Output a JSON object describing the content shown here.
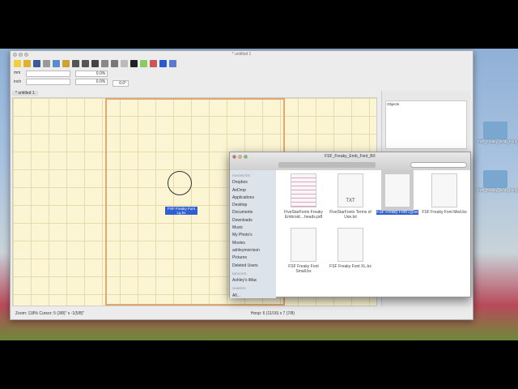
{
  "app": {
    "title": "* untitled 1",
    "tab": "* untitled 1",
    "fields": [
      {
        "unit": "mm",
        "value": "0.0%"
      },
      {
        "unit": "inch",
        "value": "0.0%"
      }
    ],
    "angle": "0.0°",
    "panel_header": "Objects",
    "status_left": "Zoom: 118% Cursor: 5 (3/8)\" x -1(5/8)\"",
    "status_right": "Hoop: 6 (11/16) x 7 (7/8)",
    "canvas_object_label": "FSF Freaky Font Lg.bx"
  },
  "finder": {
    "title": "FSF_Freaky_Emb_Font_BX",
    "search_placeholder": "",
    "sidebar": [
      {
        "section": "FAVORITES"
      },
      {
        "label": "Dropbox"
      },
      {
        "label": "AirDrop"
      },
      {
        "label": "Applications"
      },
      {
        "label": "Desktop"
      },
      {
        "label": "Documents"
      },
      {
        "label": "Downloads"
      },
      {
        "label": "Music"
      },
      {
        "label": "My Photo's"
      },
      {
        "label": "Movies"
      },
      {
        "label": "ashleymorrison"
      },
      {
        "label": "Pictures"
      },
      {
        "label": "Deleted Users"
      },
      {
        "section": "DEVICES"
      },
      {
        "label": "Ashley's iMac"
      },
      {
        "section": "SHARED"
      },
      {
        "label": "All..."
      }
    ],
    "files": [
      {
        "name": "FiveStarFonts Freaky Embroid....heads.pdf",
        "kind": "pdf"
      },
      {
        "name": "FiveStarFonts Terms of Use.txt",
        "kind": "TXT"
      },
      {
        "name": "FSF Freaky Font Lg.bx",
        "kind": "doc",
        "selected": true
      },
      {
        "name": "FSF Freaky Font Med.bx",
        "kind": "doc"
      },
      {
        "name": "FSF Freaky Font Small.bx",
        "kind": "doc"
      },
      {
        "name": "FSF Freaky Font XL.bx",
        "kind": "doc"
      }
    ]
  },
  "desktop": [
    {
      "label": "FSF_Freaky_Emb_Font_BX"
    },
    {
      "label": "FSF_Freaky_Emb_Font_BX"
    }
  ]
}
